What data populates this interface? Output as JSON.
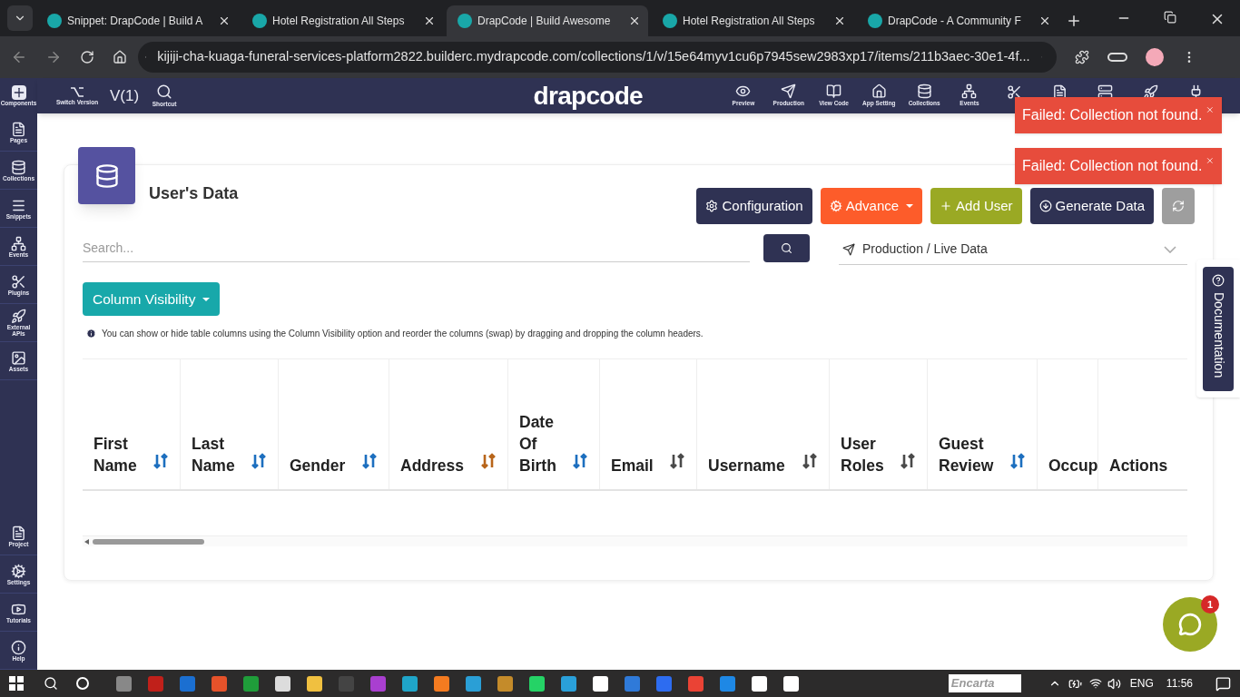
{
  "browser": {
    "tabs": [
      {
        "title": "Snippet: DrapCode | Build A",
        "selected": false
      },
      {
        "title": "Hotel Registration All Steps",
        "selected": false
      },
      {
        "title": "DrapCode | Build Awesome",
        "selected": true
      },
      {
        "title": "Hotel Registration All Steps",
        "selected": false
      },
      {
        "title": "DrapCode - A Community F",
        "selected": false
      }
    ],
    "url": "kijiji-cha-kuaga-funeral-services-platform2822.builderc.mydrapcode.com/collections/1/v/15e64myv1cu6p7945sew2983xp17/items/211b3aec-30e1-4f..."
  },
  "topbar": {
    "components": "Components",
    "switch_version": "Switch Version",
    "version": "V(1)",
    "shortcut": "Shortcut",
    "logo": "drapcode",
    "tools": [
      "Preview",
      "Production",
      "View Code",
      "App Setting",
      "Collections",
      "Events"
    ]
  },
  "sidebar": {
    "items": [
      "Pages",
      "Collections",
      "Snippets",
      "Events",
      "Plugins",
      "External APIs",
      "Assets"
    ],
    "bottom_items": [
      "Project",
      "Settings",
      "Tutorials",
      "Help"
    ]
  },
  "toasts": [
    "Failed: Collection not found.",
    "Failed: Collection not found."
  ],
  "page": {
    "title": "User's Data",
    "buttons": [
      {
        "label": "Configuration",
        "kind": "config"
      },
      {
        "label": "Advance",
        "kind": "advance"
      },
      {
        "label": "Add User",
        "kind": "add"
      },
      {
        "label": "Generate Data",
        "kind": "generate"
      },
      {
        "kind": "refresh"
      }
    ],
    "search": {
      "placeholder": "Search..."
    },
    "environment": "Production / Live Data",
    "column_visibility": "Column Visibility",
    "hint": "You can show or hide table columns using the Column Visibility option and reorder the columns (swap) by dragging and dropping the column headers.",
    "table": {
      "columns": [
        {
          "label": "First Name",
          "color": "#1d6fbf"
        },
        {
          "label": "Last Name",
          "color": "#1d6fbf"
        },
        {
          "label": "Gender",
          "color": "#1d6fbf"
        },
        {
          "label": "Address",
          "color": "#b8651a"
        },
        {
          "label": "Date Of Birth",
          "color": "#1d6fbf"
        },
        {
          "label": "Email",
          "color": "#4a4a4a"
        },
        {
          "label": "Username",
          "color": "#4a4a4a"
        },
        {
          "label": "User Roles",
          "color": "#4a4a4a"
        },
        {
          "label": "Guest Review",
          "color": "#1d6fbf"
        },
        {
          "label": "Occup"
        },
        {
          "label": "Actions"
        }
      ]
    }
  },
  "documentation": "Documentation",
  "chat": {
    "badge": "1"
  },
  "taskbar": {
    "encarta": "Encarta",
    "language": "ENG",
    "time": "11:56"
  }
}
